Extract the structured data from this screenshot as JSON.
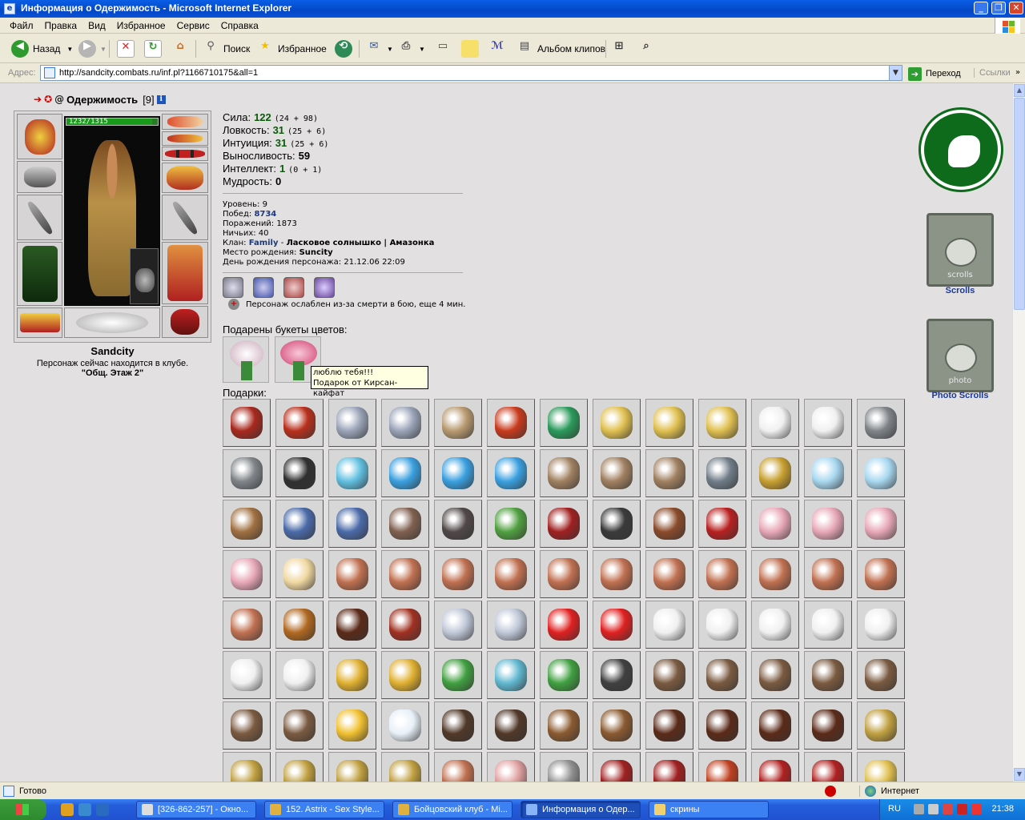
{
  "window": {
    "title": "Информация о Одержимость - Microsoft Internet Explorer",
    "minimize_glyph": "_",
    "maximize_glyph": "❐",
    "close_glyph": "✕"
  },
  "menu": [
    "Файл",
    "Правка",
    "Вид",
    "Избранное",
    "Сервис",
    "Справка"
  ],
  "toolbar": {
    "back_label": "Назад",
    "search_label": "Поиск",
    "favorites_label": "Избранное",
    "clipart_label": "Альбом клипов"
  },
  "address": {
    "label": "Адрес:",
    "url": "http://sandcity.combats.ru/inf.pl?1166710175&all=1",
    "go_label": "Переход",
    "links_label": "Ссылки"
  },
  "character": {
    "name": "Одержимость",
    "level_badge": "[9]",
    "info_glyph": "i",
    "hp": "1232/1315",
    "hp_fraction": 0.937,
    "city": "Sandcity",
    "club_status": "Персонаж сейчас находится в клубе.",
    "room": "\"Общ. Этаж 2\""
  },
  "stats": [
    {
      "label": "Сила:",
      "value": "122",
      "detail": "(24 + 98)"
    },
    {
      "label": "Ловкость:",
      "value": "31",
      "detail": "(25 + 6)"
    },
    {
      "label": "Интуиция:",
      "value": "31",
      "detail": "(25 + 6)"
    },
    {
      "label": "Выносливость:",
      "value": "59",
      "detail": ""
    },
    {
      "label": "Интеллект:",
      "value": "1",
      "detail": "(0 + 1)"
    },
    {
      "label": "Мудрость:",
      "value": "0",
      "detail": ""
    }
  ],
  "info": {
    "level": "Уровень: 9",
    "wins_label": "Побед:",
    "wins": "8734",
    "losses": "Поражений: 1873",
    "draws": "Ничьих: 40",
    "clan_label": "Клан:",
    "clan": "Family",
    "clan_sep": "-",
    "clan_motto": "Ласковое солнышко | Амазонка",
    "birthplace_label": "Место рождения:",
    "birthplace": "Suncity",
    "birthday": "День рождения персонажа: 21.12.06 22:09"
  },
  "effect": "Персонаж ослаблен из-за смерти в бою, еще 4 мин.",
  "flowers_heading": "Подарены букеты цветов:",
  "tooltip": {
    "line1": "люблю тебя!!!",
    "line2": "Подарок от Кирсан-кайфат"
  },
  "gifts_heading": "Подарки:",
  "right_panel": {
    "scrolls_label": "Scrolls",
    "scrolls_banner_text": "scrolls",
    "photo_label": "Photo Scrolls",
    "photo_banner_text": "photo"
  },
  "gift_colors": [
    [
      "#a8281c",
      "#b8301c",
      "#9aa4b8",
      "#9aa4b8",
      "#b89a70",
      "#c83a1c",
      "#2a9a5a",
      "#e0c050",
      "#e0c050",
      "#e0c050",
      "#f0f0f0",
      "#f0f0f0",
      "#808488"
    ],
    [
      "#808488",
      "#303030",
      "#60c0e0",
      "#3aa0e0",
      "#3aa0e0",
      "#3aa0e0",
      "#a08060",
      "#a08060",
      "#a08060",
      "#707c88",
      "#c8a030",
      "#a8d8f0",
      "#a8d8f0"
    ],
    [
      "#a07040",
      "#4a6aa8",
      "#4a6aa8",
      "#806050",
      "#504848",
      "#50a040",
      "#a02020",
      "#3a3a3a",
      "#8a4a2a",
      "#b82020",
      "#e8a8b8",
      "#e8a8b8",
      "#e8a8b8"
    ],
    [
      "#e8a8b8",
      "#f0d8a0",
      "#c07050",
      "#c07050",
      "#c07050",
      "#c07050",
      "#c07050",
      "#c07050",
      "#c07050",
      "#c07050",
      "#c07050",
      "#c07050",
      "#c07050"
    ],
    [
      "#c07050",
      "#b06820",
      "#5a2a18",
      "#a03020",
      "#c0c8d8",
      "#c0c8d8",
      "#e02020",
      "#e02020",
      "#f0f0f0",
      "#f0f0f0",
      "#f0f0f0",
      "#f0f0f0",
      "#f0f0f0"
    ],
    [
      "#f0f0f0",
      "#f0f0f0",
      "#e0b030",
      "#e0b030",
      "#40a040",
      "#60b8d0",
      "#40a040",
      "#404040",
      "#7a5a40",
      "#7a5a40",
      "#7a5a40",
      "#7a5a40",
      "#7a5a40"
    ],
    [
      "#7a5a40",
      "#7a5a40",
      "#f0c030",
      "#e8f0f8",
      "#503828",
      "#503828",
      "#8a5a30",
      "#8a5a30",
      "#5a2a18",
      "#5a2a18",
      "#5a2a18",
      "#5a2a18",
      "#c0a040"
    ],
    [
      "#c0a040",
      "#c0a040",
      "#c0a040",
      "#c0a040",
      "#c07050",
      "#e0a0a0",
      "#909090",
      "#a02020",
      "#a02020",
      "#c04020",
      "#b02020",
      "#b02020",
      "#e0c050"
    ]
  ],
  "taskbar": {
    "tasks": [
      "[326-862-257] - Окно...",
      "152. Astrix - Sex Style...",
      "Бойцовский клуб - Mi...",
      "Информация о Одер...",
      "скрины"
    ],
    "lang": "RU",
    "time": "21:38"
  },
  "status": {
    "ready": "Готово",
    "zone": "Интернет"
  }
}
